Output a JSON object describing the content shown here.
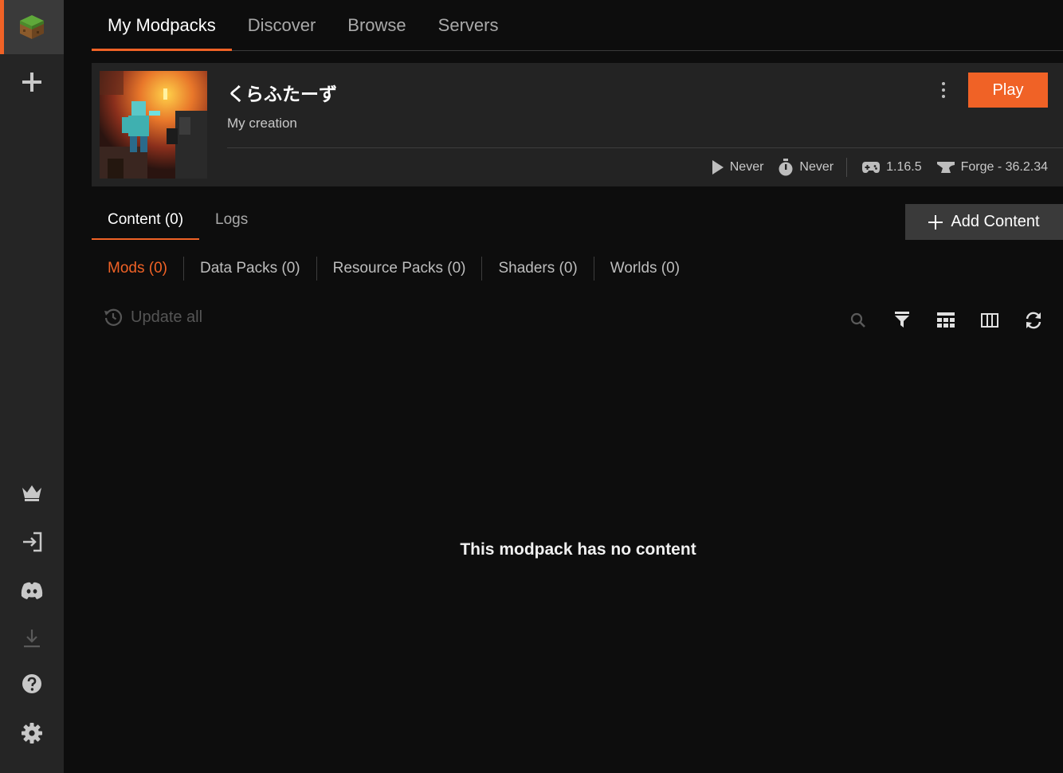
{
  "sidebar": {
    "logo_icon": "grass-block-icon",
    "items": [
      {
        "icon": "plus-icon"
      },
      {
        "icon": "crown-icon"
      },
      {
        "icon": "login-icon"
      },
      {
        "icon": "discord-icon"
      },
      {
        "icon": "download-icon"
      },
      {
        "icon": "help-icon"
      },
      {
        "icon": "gear-icon"
      }
    ]
  },
  "top_tabs": [
    {
      "label": "My Modpacks",
      "active": true
    },
    {
      "label": "Discover",
      "active": false
    },
    {
      "label": "Browse",
      "active": false
    },
    {
      "label": "Servers",
      "active": false
    }
  ],
  "pack": {
    "title": "くらふたーず",
    "subtitle": "My creation",
    "play_label": "Play",
    "last_played": "Never",
    "play_time": "Never",
    "game_version": "1.16.5",
    "loader": "Forge - 36.2.34"
  },
  "sub_tabs": [
    {
      "label": "Content (0)",
      "active": true
    },
    {
      "label": "Logs",
      "active": false
    }
  ],
  "add_content_label": "Add Content",
  "filters": [
    {
      "label": "Mods (0)",
      "active": true
    },
    {
      "label": "Data Packs (0)",
      "active": false
    },
    {
      "label": "Resource Packs (0)",
      "active": false
    },
    {
      "label": "Shaders (0)",
      "active": false
    },
    {
      "label": "Worlds (0)",
      "active": false
    }
  ],
  "update_all_label": "Update all",
  "empty_message": "This modpack has no content",
  "colors": {
    "accent": "#f06226",
    "sidebar_bg": "#252525",
    "main_bg": "#0d0d0d",
    "card_bg": "#232323"
  }
}
